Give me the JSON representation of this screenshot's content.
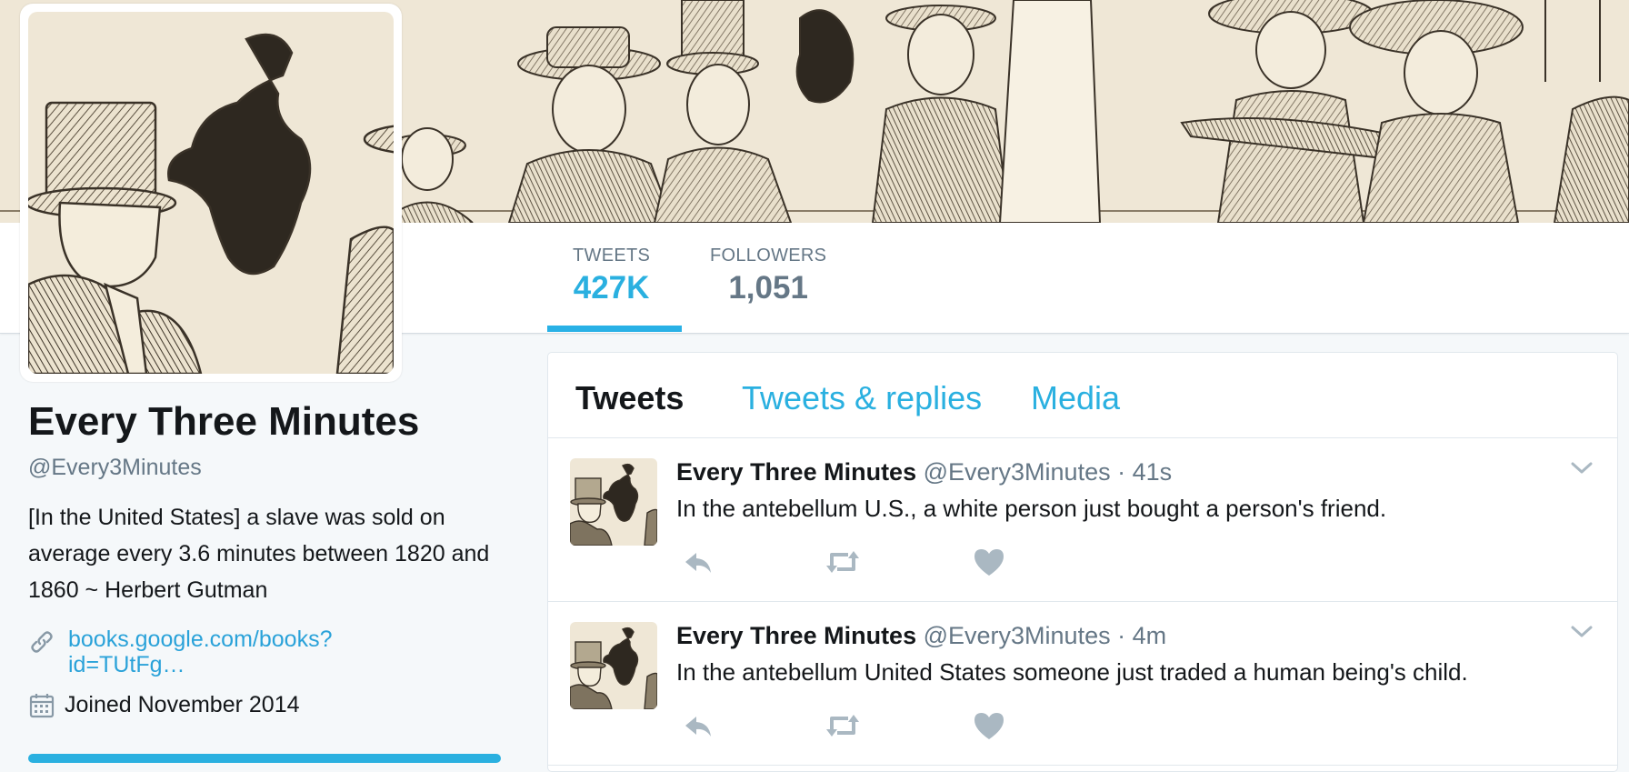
{
  "nav": {
    "stats": [
      {
        "label": "TWEETS",
        "value": "427K",
        "active": true
      },
      {
        "label": "FOLLOWERS",
        "value": "1,051",
        "active": false
      }
    ]
  },
  "profile": {
    "name": "Every Three Minutes",
    "handle": "@Every3Minutes",
    "bio": "[In the United States] a slave was sold on average every 3.6 minutes between 1820 and 1860 ~ Herbert Gutman",
    "url_line1": "books.google.com/books?",
    "url_line2": "id=TUtFg…",
    "joined": "Joined November 2014",
    "icons": {
      "link": "link-icon",
      "calendar": "calendar-icon"
    }
  },
  "timeline": {
    "tabs": [
      "Tweets",
      "Tweets & replies",
      "Media"
    ],
    "tweets": [
      {
        "name": "Every Three Minutes",
        "handle": "@Every3Minutes",
        "sep": "·",
        "time": "41s",
        "text": "In the antebellum U.S.,  a white person just bought a person's friend."
      },
      {
        "name": "Every Three Minutes",
        "handle": "@Every3Minutes",
        "sep": "·",
        "time": "4m",
        "text": "In the antebellum United States  someone just traded a human being's child."
      }
    ],
    "action_icons": [
      "reply-icon",
      "retweet-icon",
      "like-icon"
    ]
  },
  "colors": {
    "accent": "#2ab0e0",
    "muted": "#657786",
    "text": "#14171a",
    "page_bg": "#f5f8fa",
    "icon_gray": "#aab8c2",
    "engraving_paper": "#efe7d6",
    "engraving_ink": "#3a3228"
  }
}
